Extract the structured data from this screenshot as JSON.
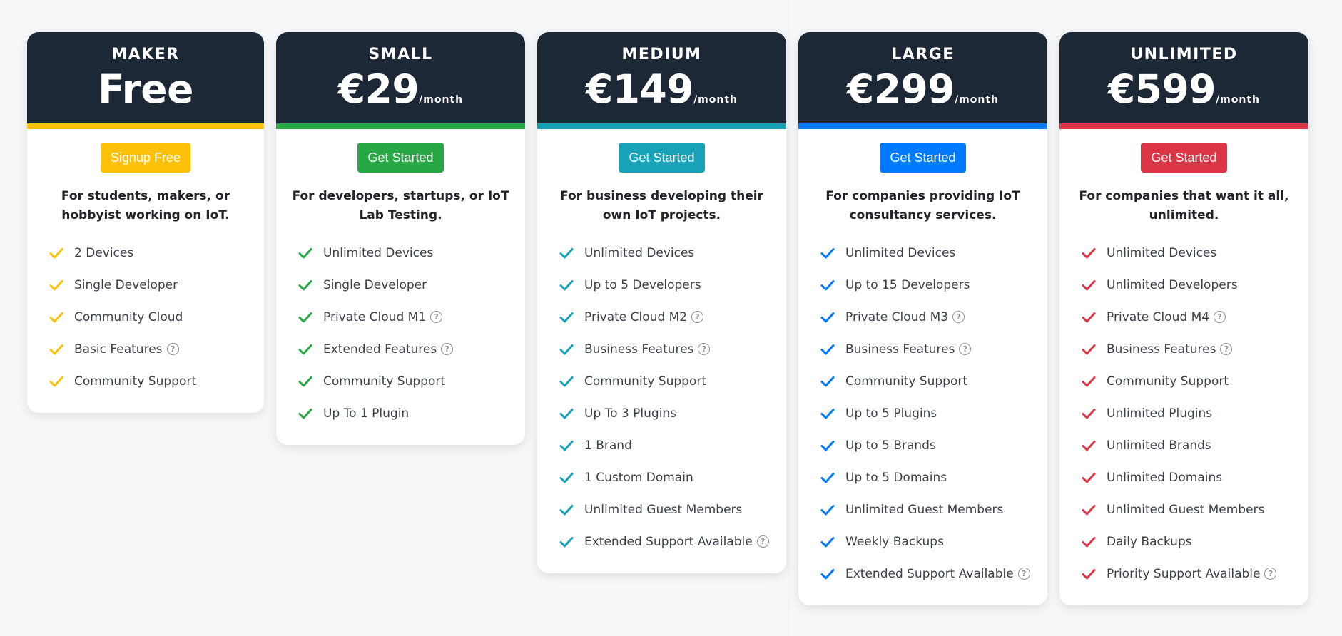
{
  "plans": [
    {
      "name": "MAKER",
      "price": "Free",
      "per": "",
      "accent": "#ffc107",
      "button": "Signup Free",
      "description": "For students, makers, or hobbyist working on IoT.",
      "features": [
        {
          "text": "2 Devices",
          "help": false
        },
        {
          "text": "Single Developer",
          "help": false
        },
        {
          "text": "Community Cloud",
          "help": false
        },
        {
          "text": "Basic Features",
          "help": true
        },
        {
          "text": "Community Support",
          "help": false
        }
      ]
    },
    {
      "name": "SMALL",
      "price": "€29",
      "per": "/month",
      "accent": "#28a745",
      "button": "Get Started",
      "description": "For developers, startups, or IoT Lab Testing.",
      "features": [
        {
          "text": "Unlimited Devices",
          "help": false
        },
        {
          "text": "Single Developer",
          "help": false
        },
        {
          "text": "Private Cloud M1",
          "help": true
        },
        {
          "text": "Extended Features",
          "help": true
        },
        {
          "text": "Community Support",
          "help": false
        },
        {
          "text": "Up To 1 Plugin",
          "help": false
        }
      ]
    },
    {
      "name": "MEDIUM",
      "price": "€149",
      "per": "/month",
      "accent": "#17a2b8",
      "button": "Get Started",
      "description": "For business developing their own IoT projects.",
      "features": [
        {
          "text": "Unlimited Devices",
          "help": false
        },
        {
          "text": "Up to 5 Developers",
          "help": false
        },
        {
          "text": "Private Cloud M2",
          "help": true
        },
        {
          "text": "Business Features",
          "help": true
        },
        {
          "text": "Community Support",
          "help": false
        },
        {
          "text": "Up To 3 Plugins",
          "help": false
        },
        {
          "text": "1 Brand",
          "help": false
        },
        {
          "text": "1 Custom Domain",
          "help": false
        },
        {
          "text": "Unlimited Guest Members",
          "help": false
        },
        {
          "text": "Extended Support Available",
          "help": true
        }
      ]
    },
    {
      "name": "LARGE",
      "price": "€299",
      "per": "/month",
      "accent": "#007bff",
      "button": "Get Started",
      "description": "For companies providing IoT consultancy services.",
      "features": [
        {
          "text": "Unlimited Devices",
          "help": false
        },
        {
          "text": "Up to 15 Developers",
          "help": false
        },
        {
          "text": "Private Cloud M3",
          "help": true
        },
        {
          "text": "Business Features",
          "help": true
        },
        {
          "text": "Community Support",
          "help": false
        },
        {
          "text": "Up to 5 Plugins",
          "help": false
        },
        {
          "text": "Up to 5 Brands",
          "help": false
        },
        {
          "text": "Up to 5 Domains",
          "help": false
        },
        {
          "text": "Unlimited Guest Members",
          "help": false
        },
        {
          "text": "Weekly Backups",
          "help": false
        },
        {
          "text": "Extended Support Available",
          "help": true
        }
      ]
    },
    {
      "name": "UNLIMITED",
      "price": "€599",
      "per": "/month",
      "accent": "#dc3545",
      "button": "Get Started",
      "description": "For companies that want it all, unlimited.",
      "features": [
        {
          "text": "Unlimited Devices",
          "help": false
        },
        {
          "text": "Unlimited Developers",
          "help": false
        },
        {
          "text": "Private Cloud M4",
          "help": true
        },
        {
          "text": "Business Features",
          "help": true
        },
        {
          "text": "Community Support",
          "help": false
        },
        {
          "text": "Unlimited Plugins",
          "help": false
        },
        {
          "text": "Unlimited Brands",
          "help": false
        },
        {
          "text": "Unlimited Domains",
          "help": false
        },
        {
          "text": "Unlimited Guest Members",
          "help": false
        },
        {
          "text": "Daily Backups",
          "help": false
        },
        {
          "text": "Priority Support Available",
          "help": true
        }
      ]
    }
  ],
  "help_icon": "question-circle-icon",
  "check_icon": "check-icon"
}
